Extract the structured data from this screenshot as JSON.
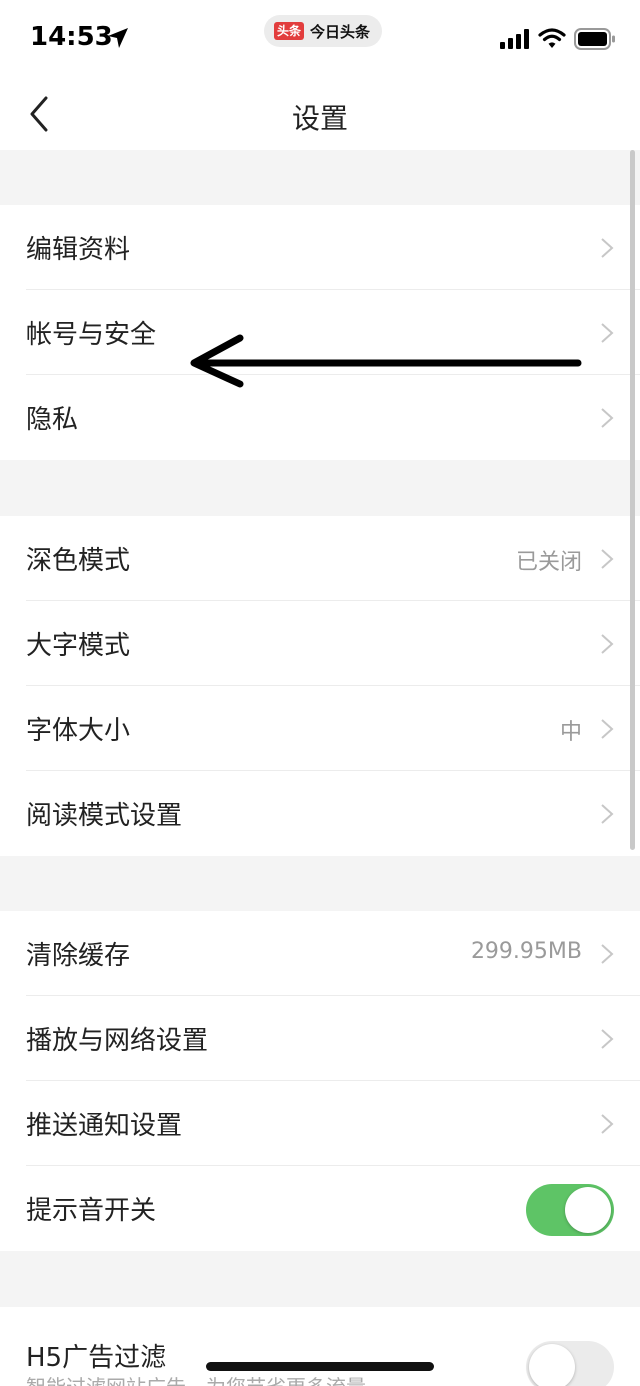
{
  "status_bar": {
    "time": "14:53",
    "app_pill": {
      "logo": "头条",
      "name": "今日头条"
    },
    "icons": [
      "location-arrow-icon",
      "signal-icon",
      "wifi-icon",
      "battery-icon"
    ]
  },
  "nav": {
    "title": "设置",
    "back_icon": "chevron-left-icon"
  },
  "groups": [
    {
      "rows": [
        {
          "label": "编辑资料"
        },
        {
          "label": "帐号与安全"
        },
        {
          "label": "隐私"
        }
      ]
    },
    {
      "rows": [
        {
          "label": "深色模式",
          "value": "已关闭"
        },
        {
          "label": "大字模式"
        },
        {
          "label": "字体大小",
          "value": "中"
        },
        {
          "label": "阅读模式设置"
        }
      ]
    },
    {
      "rows": [
        {
          "label": "清除缓存",
          "value": "299.95MB"
        },
        {
          "label": "播放与网络设置"
        },
        {
          "label": "推送通知设置"
        },
        {
          "label": "提示音开关",
          "toggle": "on"
        }
      ]
    },
    {
      "rows": [
        {
          "label": "H5广告过滤",
          "sublabel": "智能过滤网站广告，为您节省更多流量",
          "toggle": "off"
        }
      ]
    }
  ],
  "colors": {
    "toggle_on": "#5ec466",
    "toggle_off": "#ebebeb",
    "background": "#f4f4f4",
    "value_text": "#9a9a9a"
  }
}
